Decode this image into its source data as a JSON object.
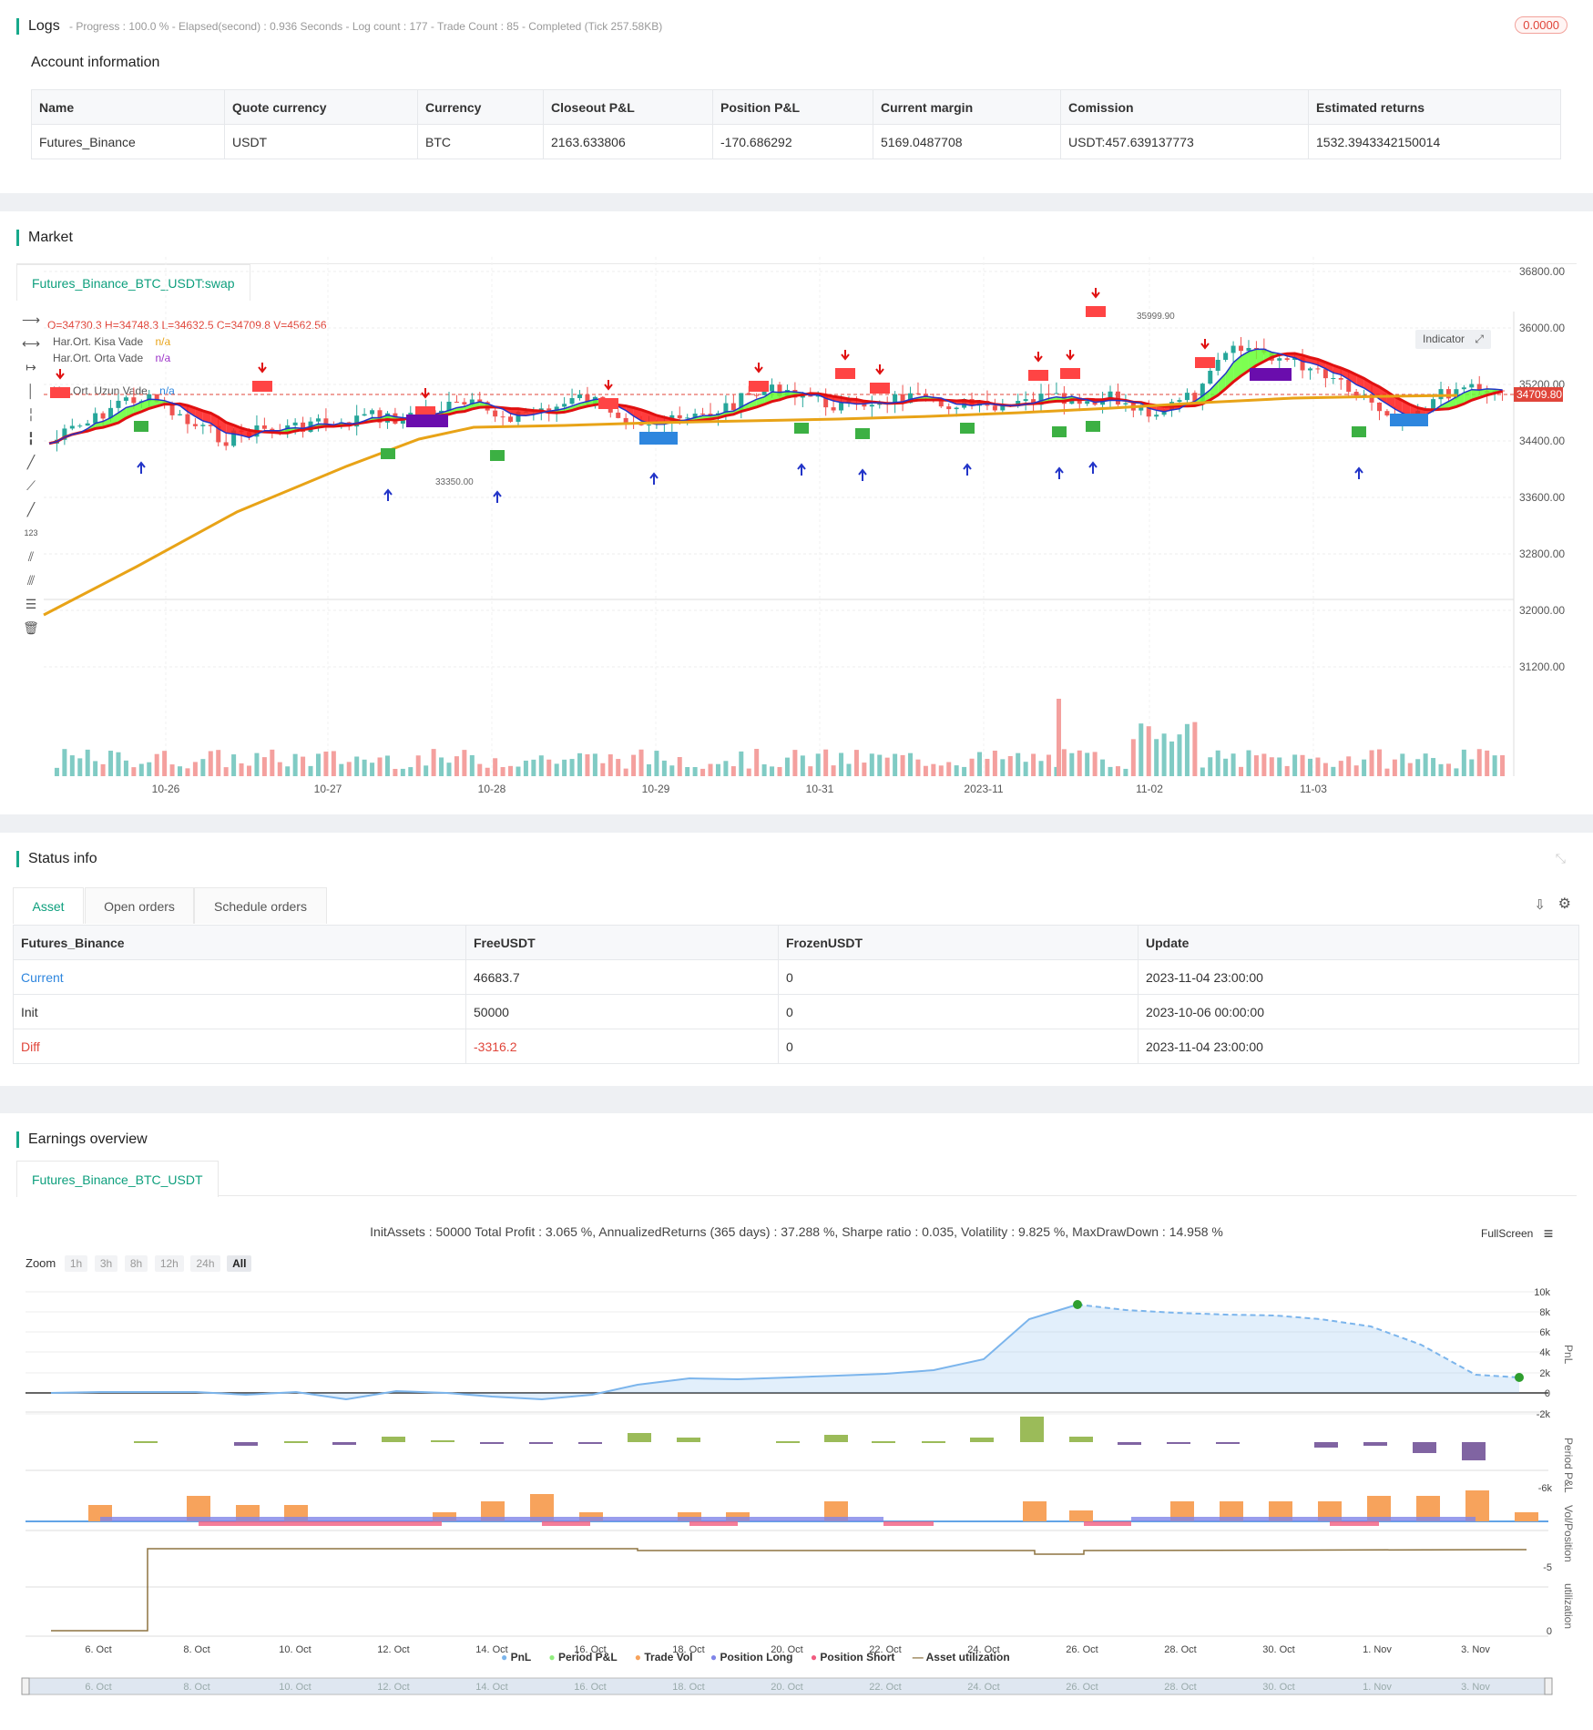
{
  "logs": {
    "title": "Logs",
    "status": "- Progress : 100.0 % - Elapsed(second) : 0.936  Seconds - Log count : 177 - Trade Count : 85 - Completed (Tick 257.58KB)",
    "badge": "0.0000"
  },
  "account": {
    "title": "Account information",
    "headers": [
      "Name",
      "Quote currency",
      "Currency",
      "Closeout P&L",
      "Position P&L",
      "Current margin",
      "Comission",
      "Estimated returns"
    ],
    "row": [
      "Futures_Binance",
      "USDT",
      "BTC",
      "2163.633806",
      "-170.686292",
      "5169.0487708",
      "USDT:457.639137773",
      "1532.3943342150014"
    ]
  },
  "market": {
    "title": "Market",
    "tab": "Futures_Binance_BTC_USDT:swap",
    "ohlc": "O=34730.3 H=34748.3 L=34632.5 C=34709.8 V=4562.56",
    "legend": [
      {
        "name": "Har.Ort. Kisa Vade",
        "value": "n/a",
        "color": "#e8a317"
      },
      {
        "name": "Har.Ort. Orta Vade",
        "value": "n/a",
        "color": "#9b30c8"
      },
      {
        "name": "Har.Ort. Uzun Vade",
        "value": "n/a",
        "color": "#2e86de"
      }
    ],
    "indicator_btn": "Indicator",
    "price_ticks": [
      "36800.00",
      "36000.00",
      "35200.00",
      "34400.00",
      "33600.00",
      "32800.00",
      "32000.00",
      "31200.00"
    ],
    "last_price": "34709.80",
    "date_ticks": [
      "10-26",
      "10-27",
      "10-28",
      "10-29",
      "10-31",
      "2023-11",
      "11-02",
      "11-03"
    ],
    "high_label": "35999.90",
    "low_label": "33350.00"
  },
  "status": {
    "title": "Status info",
    "tabs": [
      "Asset",
      "Open orders",
      "Schedule orders"
    ],
    "headers": [
      "Futures_Binance",
      "FreeUSDT",
      "FrozenUSDT",
      "Update"
    ],
    "rows": [
      {
        "label": "Current",
        "free": "46683.7",
        "frozen": "0",
        "update": "2023-11-04 23:00:00"
      },
      {
        "label": "Init",
        "free": "50000",
        "frozen": "0",
        "update": "2023-10-06 00:00:00"
      },
      {
        "label": "Diff",
        "free": "-3316.2",
        "frozen": "0",
        "update": "2023-11-04 23:00:00"
      }
    ]
  },
  "earnings": {
    "title": "Earnings overview",
    "tab": "Futures_Binance_BTC_USDT",
    "summary": "InitAssets : 50000 Total Profit : 3.065 %, AnnualizedReturns (365 days) : 37.288 %, Sharpe ratio : 0.035, Volatility : 9.825 %, MaxDrawDown : 14.958 %",
    "fullscreen": "FullScreen",
    "zoom_label": "Zoom",
    "zoom_buttons": [
      "1h",
      "3h",
      "8h",
      "12h",
      "24h",
      "All"
    ],
    "pnl_ticks": [
      "10k",
      "8k",
      "6k",
      "4k",
      "2k",
      "0",
      "-2k"
    ],
    "axis_titles": [
      "PnL",
      "Period P&L",
      "Vol/Position",
      "utilization"
    ],
    "period_tick": "-6k",
    "vol_tick": "-5",
    "util_tick": "0",
    "date_ticks": [
      "6. Oct",
      "8. Oct",
      "10. Oct",
      "12. Oct",
      "14. Oct",
      "16. Oct",
      "18. Oct",
      "20. Oct",
      "22. Oct",
      "24. Oct",
      "26. Oct",
      "28. Oct",
      "30. Oct",
      "1. Nov",
      "3. Nov"
    ],
    "legend": [
      {
        "name": "PnL",
        "color": "#7cb5ec"
      },
      {
        "name": "Period P&L",
        "color": "#90ed7d"
      },
      {
        "name": "Trade Vol",
        "color": "#f7a35c"
      },
      {
        "name": "Position Long",
        "color": "#8085e9"
      },
      {
        "name": "Position Short",
        "color": "#f15c80"
      },
      {
        "name": "Asset utilization",
        "color": "#8d7340"
      }
    ]
  }
}
